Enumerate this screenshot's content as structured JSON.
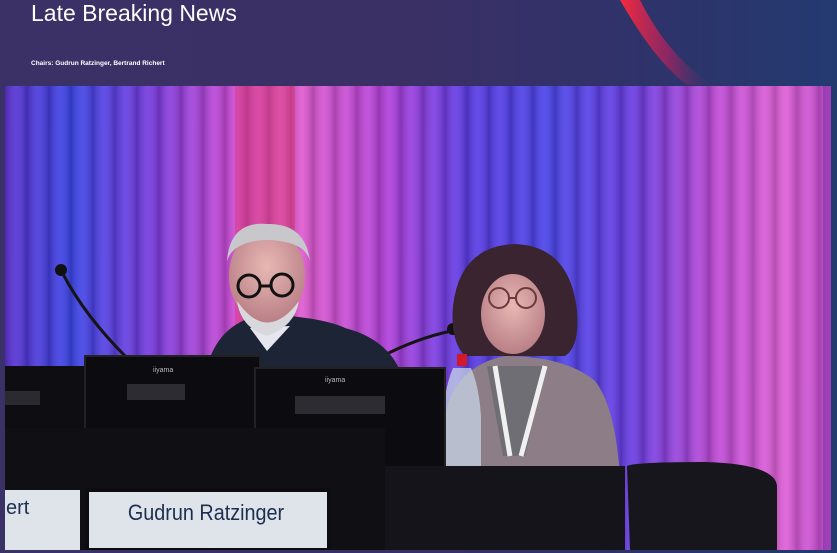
{
  "header": {
    "title": "Late Breaking News",
    "chairs": "Chairs: Gudrun Ratzinger, Bertrand Richert"
  },
  "stage": {
    "nameplate_main": "Gudrun Ratzinger",
    "nameplate_left_partial": "ert",
    "monitor_brand_1": "iiyama",
    "monitor_brand_2": "iiyama"
  },
  "colors": {
    "header_bg": "#3a3065",
    "curtain_blue": "#4a3ae0",
    "curtain_magenta": "#d14bd8",
    "accent_red": "#e8203a"
  }
}
